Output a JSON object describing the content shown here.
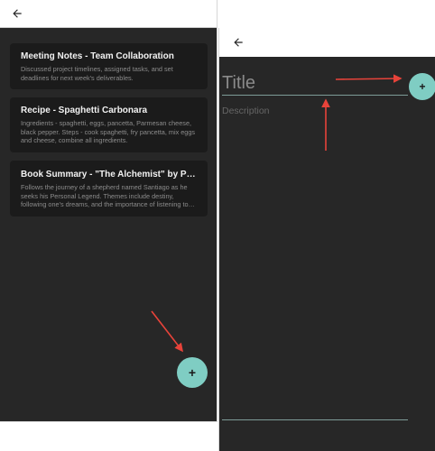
{
  "colors": {
    "accent": "#7fcdc3",
    "background": "#272727",
    "card": "#1b1b1b",
    "annotation": "#e8433a"
  },
  "left_screen": {
    "back_icon": "arrow-left-icon",
    "notes": [
      {
        "title": "Meeting Notes - Team Collaboration",
        "body": "Discussed project timelines, assigned tasks, and set deadlines for next week's deliverables."
      },
      {
        "title": "Recipe - Spaghetti Carbonara",
        "body": "Ingredients - spaghetti, eggs, pancetta, Parmesan cheese, black pepper. Steps - cook spaghetti, fry pancetta, mix eggs and cheese, combine all ingredients."
      },
      {
        "title": "Book Summary - \"The Alchemist\" by Paulo Coelho",
        "body": "Follows the journey of a shepherd named Santiago as he seeks his Personal Legend. Themes include destiny, following one's dreams, and the importance of listening to one's heart."
      }
    ],
    "fab_label": "+"
  },
  "right_screen": {
    "back_icon": "arrow-left-icon",
    "title_placeholder": "Title",
    "description_placeholder": "Description",
    "fab_label": "+"
  }
}
